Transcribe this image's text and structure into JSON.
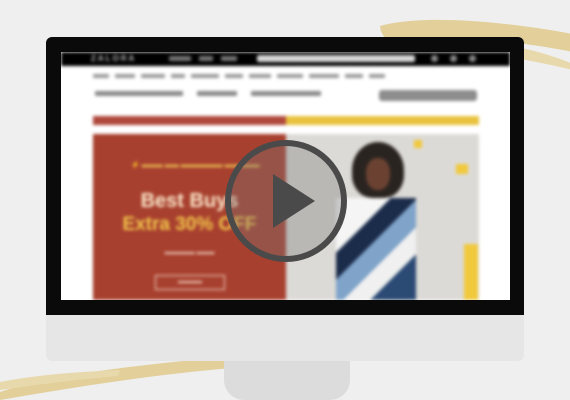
{
  "site": {
    "logo": "ZALORA",
    "hero": {
      "title": "Best Buys",
      "subtitle": "Extra 30% OFF"
    }
  },
  "overlay": {
    "icon": "play-icon"
  },
  "colors": {
    "background": "#efefef",
    "brush": "#e2cf9a",
    "hero_red": "#a8402f",
    "hero_gold": "#f2c64a",
    "play_ring": "#4a4a4a"
  }
}
